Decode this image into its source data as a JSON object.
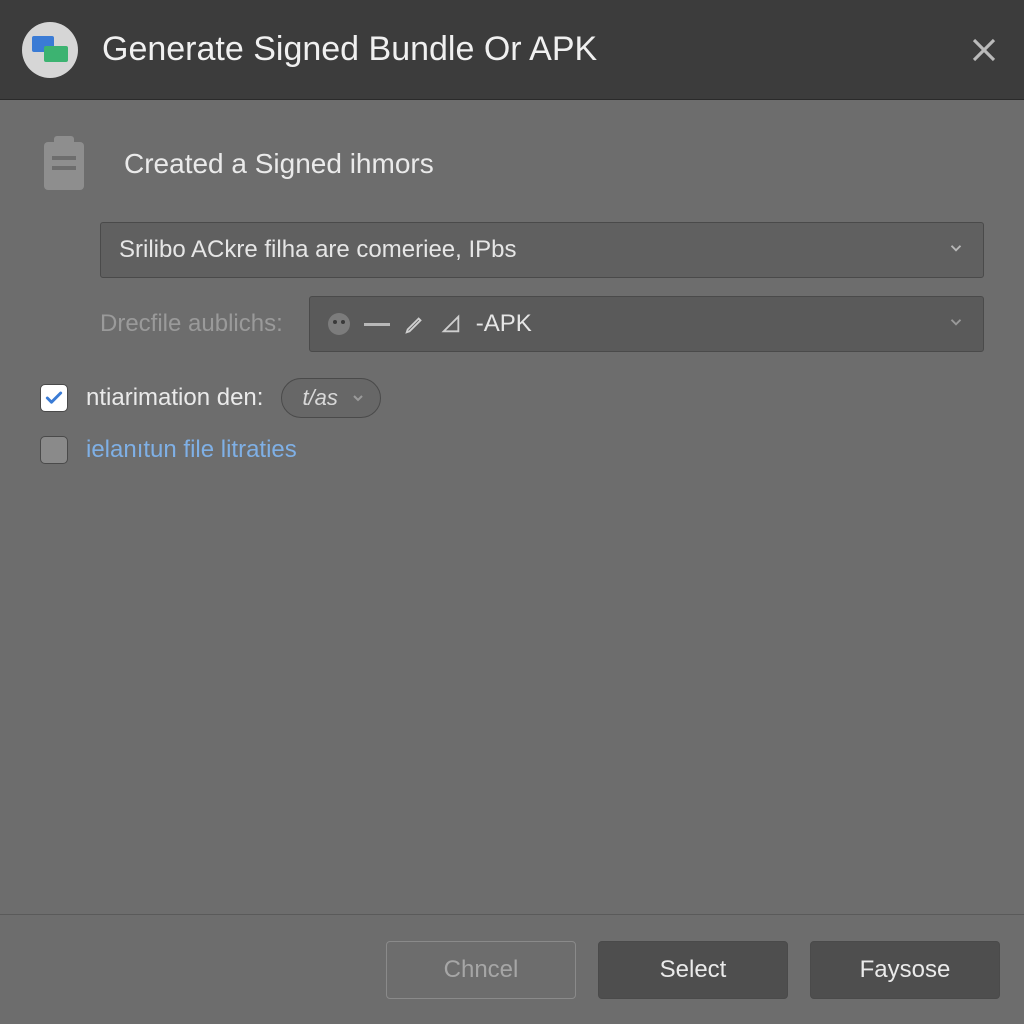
{
  "titlebar": {
    "title": "Generate Signed Bundle Or APK"
  },
  "section": {
    "heading": "Created a Signed ihmors"
  },
  "module_combo": {
    "text": "Srilibo ACkre filha are comeriee, IPbs"
  },
  "variant_row": {
    "label": "Drecfile aublichs:",
    "text": "-APK"
  },
  "check1": {
    "checked": true,
    "label": "ntiarimation den:",
    "mini": "t/as"
  },
  "check2": {
    "checked": false,
    "label": "ielanıtun file litraties"
  },
  "footer": {
    "cancel": "Chncel",
    "select": "Select",
    "finish": "Faysose"
  }
}
